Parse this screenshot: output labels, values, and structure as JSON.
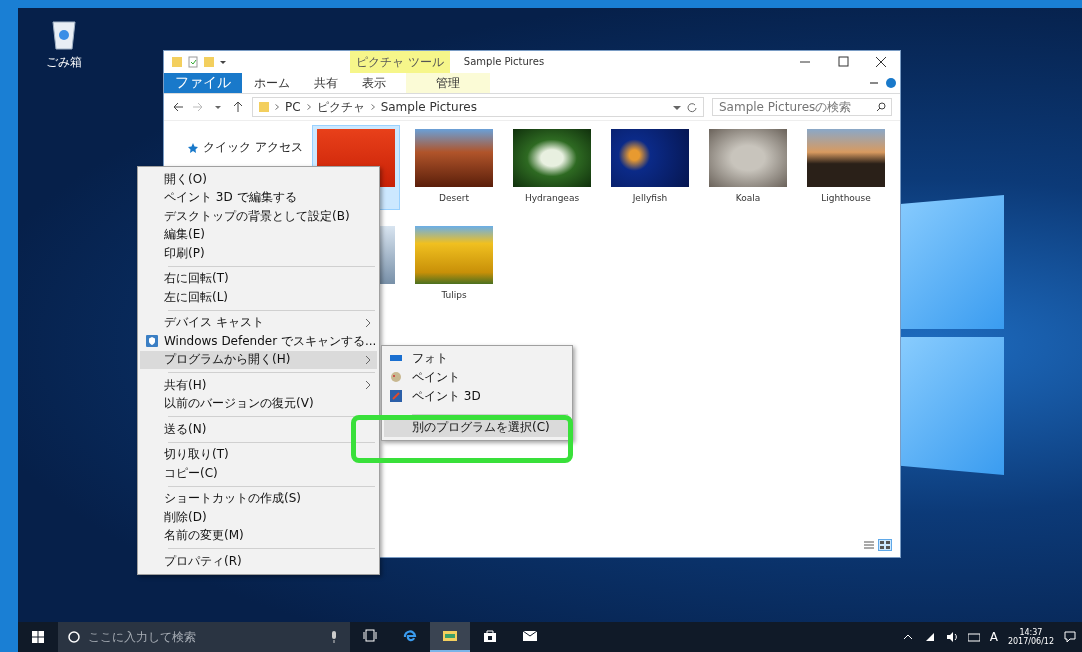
{
  "desktop_icons": [
    {
      "label": "ごみ箱"
    }
  ],
  "explorer": {
    "title": "Sample Pictures",
    "ribbon_tabs": [
      {
        "label": "ファイル",
        "kind": "file"
      },
      {
        "label": "ホーム",
        "kind": "tab"
      },
      {
        "label": "共有",
        "kind": "tab"
      },
      {
        "label": "表示",
        "kind": "tab"
      },
      {
        "label": "管理",
        "kind": "contextual"
      }
    ],
    "contextual_group": "ピクチャ ツール",
    "address": [
      "PC",
      "ピクチャ",
      "Sample Pictures"
    ],
    "search": {
      "placeholder": "Sample Picturesの検索"
    },
    "nav_items": [
      {
        "label": "クイック アクセス"
      }
    ],
    "files": [
      {
        "selected": true
      },
      {
        "name": "Desert",
        "selected": false
      },
      {
        "name": "Hydrangeas",
        "selected": false
      },
      {
        "name": "Jellyfish",
        "selected": false
      },
      {
        "name": "Koala",
        "selected": false
      },
      {
        "name": "Lighthouse",
        "selected": false
      },
      {
        "selected": false
      },
      {
        "name": "Tulips",
        "selected": false
      }
    ],
    "views": [
      {
        "selected": false
      },
      {
        "selected": true
      }
    ]
  },
  "context_menu": {
    "items": [
      {
        "kind": "item",
        "label": "開く(O)",
        "submenu": false,
        "selected": false
      },
      {
        "kind": "item",
        "label": "ペイント 3D で編集する",
        "submenu": false,
        "selected": false
      },
      {
        "kind": "item",
        "label": "デスクトップの背景として設定(B)",
        "submenu": false,
        "selected": false
      },
      {
        "kind": "item",
        "label": "編集(E)",
        "submenu": false,
        "selected": false
      },
      {
        "kind": "item",
        "label": "印刷(P)",
        "submenu": false,
        "selected": false
      },
      {
        "kind": "separator"
      },
      {
        "kind": "item",
        "label": "右に回転(T)",
        "submenu": false,
        "selected": false
      },
      {
        "kind": "item",
        "label": "左に回転(L)",
        "submenu": false,
        "selected": false
      },
      {
        "kind": "separator"
      },
      {
        "kind": "item",
        "label": "デバイス キャスト",
        "submenu": true,
        "selected": false
      },
      {
        "kind": "shield",
        "label": "Windows Defender でスキャンする...",
        "submenu": false,
        "selected": false
      },
      {
        "kind": "item",
        "label": "プログラムから開く(H)",
        "submenu": true,
        "selected": true
      },
      {
        "kind": "separator"
      },
      {
        "kind": "item",
        "label": "共有(H)",
        "submenu": true,
        "selected": false
      },
      {
        "kind": "item",
        "label": "以前のバージョンの復元(V)",
        "submenu": false,
        "selected": false
      },
      {
        "kind": "separator"
      },
      {
        "kind": "item",
        "label": "送る(N)",
        "submenu": false,
        "selected": false
      },
      {
        "kind": "separator"
      },
      {
        "kind": "item",
        "label": "切り取り(T)",
        "submenu": false,
        "selected": false
      },
      {
        "kind": "item",
        "label": "コピー(C)",
        "submenu": false,
        "selected": false
      },
      {
        "kind": "separator"
      },
      {
        "kind": "item",
        "label": "ショートカットの作成(S)",
        "submenu": false,
        "selected": false
      },
      {
        "kind": "item",
        "label": "削除(D)",
        "submenu": false,
        "selected": false
      },
      {
        "kind": "item",
        "label": "名前の変更(M)",
        "submenu": false,
        "selected": false
      },
      {
        "kind": "separator"
      },
      {
        "kind": "item",
        "label": "プロパティ(R)",
        "submenu": false,
        "selected": false
      }
    ]
  },
  "open_with_menu": {
    "items": [
      {
        "kind": "photos",
        "label": "フォト",
        "selected": false
      },
      {
        "kind": "paint",
        "label": "ペイント",
        "selected": false
      },
      {
        "kind": "paint3d",
        "label": "ペイント 3D",
        "selected": false
      },
      {
        "kind": "separator"
      },
      {
        "kind": "item",
        "label": "別のプログラムを選択(C)",
        "selected": true
      }
    ]
  },
  "taskbar": {
    "search": {
      "placeholder": "ここに入力して検索"
    },
    "apps": [
      {
        "kind": "taskview",
        "selected": false
      },
      {
        "kind": "edge",
        "selected": false
      },
      {
        "kind": "explorer",
        "selected": true
      },
      {
        "kind": "store",
        "selected": false
      },
      {
        "kind": "mail",
        "selected": false
      }
    ],
    "ime": "A",
    "time": "14:37",
    "date": "2017/06/12"
  }
}
